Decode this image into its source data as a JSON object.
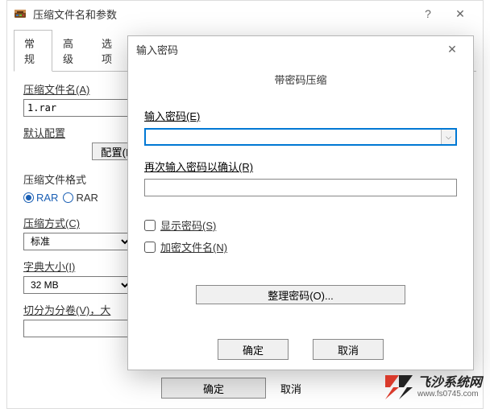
{
  "parent": {
    "title": "压缩文件名和参数",
    "help_glyph": "?",
    "close_glyph": "✕",
    "tabs": {
      "general": "常规",
      "advanced": "高级",
      "options": "选项"
    },
    "filename_label": "压缩文件名(A)",
    "filename_value": "1.rar",
    "profile_label": "默认配置",
    "config_btn": "配置(F)",
    "format_label": "压缩文件格式",
    "format_rar": "RAR",
    "format_rar2": "RAR",
    "method_label": "压缩方式(C)",
    "method_value": "标准",
    "dict_label": "字典大小(I)",
    "dict_value": "32 MB",
    "split_label": "切分为分卷(V)，大",
    "ok": "确定",
    "cancel": "取消"
  },
  "modal": {
    "title": "输入密码",
    "close_glyph": "✕",
    "heading": "带密码压缩",
    "enter_pw_label": "输入密码(E)",
    "reenter_pw_label": "再次输入密码以确认(R)",
    "show_pw_label": "显示密码(S)",
    "encrypt_names_label": "加密文件名(N)",
    "organize_btn": "整理密码(O)...",
    "ok": "确定",
    "cancel": "取消",
    "dropdown_glyph": "⌵"
  },
  "watermark": {
    "cn": "飞沙系统网",
    "url": "www.fs0745.com"
  }
}
